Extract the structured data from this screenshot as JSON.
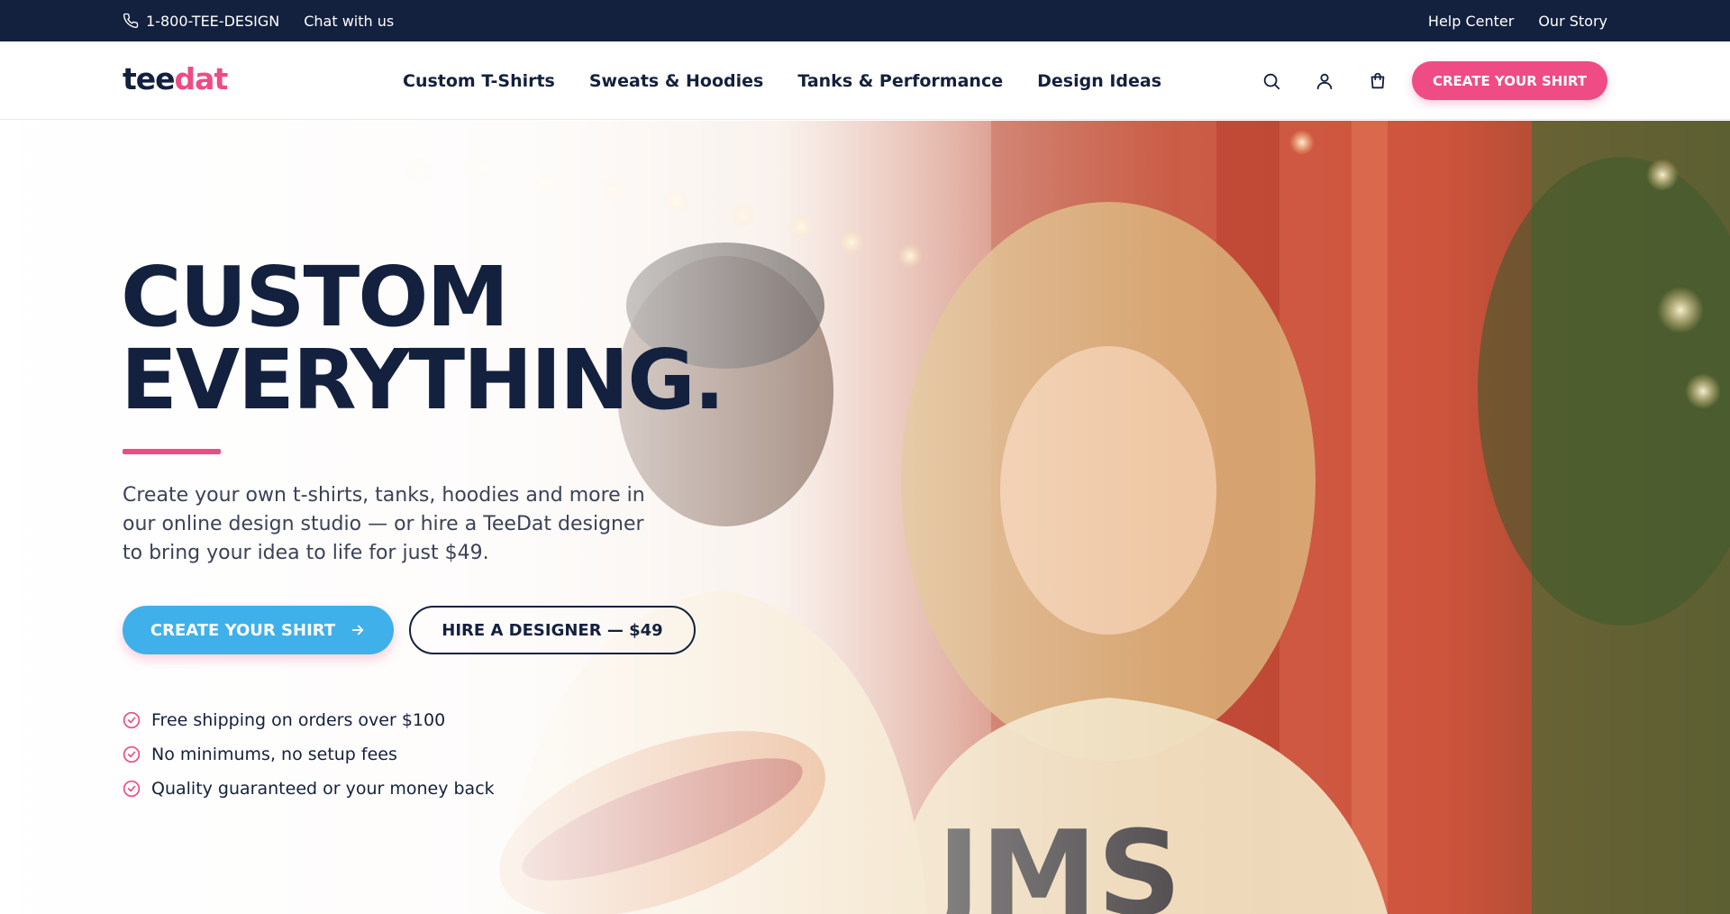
{
  "topbar": {
    "phone": "1-800-TEE-DESIGN",
    "chat": "Chat with us",
    "help": "Help Center",
    "story": "Our Story"
  },
  "nav": {
    "logo_part1": "tee",
    "logo_part2": "dat",
    "links": [
      "Custom T-Shirts",
      "Sweats & Hoodies",
      "Tanks & Performance",
      "Design Ideas"
    ],
    "icons": [
      "search-icon",
      "user-icon",
      "cart-icon"
    ],
    "cta": "CREATE YOUR SHIRT"
  },
  "hero": {
    "title_line1": "CUSTOM",
    "title_line2": "EVERYTHING.",
    "description": "Create your own t-shirts, tanks, hoodies and more in our online design studio — or hire a TeeDat designer to bring your idea to life for just $49.",
    "primary_button": "CREATE YOUR SHIRT",
    "secondary_button": "HIRE A DESIGNER — $49",
    "features": [
      "Free shipping on orders over $100",
      "No minimums, no setup fees",
      "Quality guaranteed or your money back"
    ]
  },
  "colors": {
    "navy": "#13213f",
    "pink": "#ef4b84",
    "blue": "#3fb0ea"
  }
}
